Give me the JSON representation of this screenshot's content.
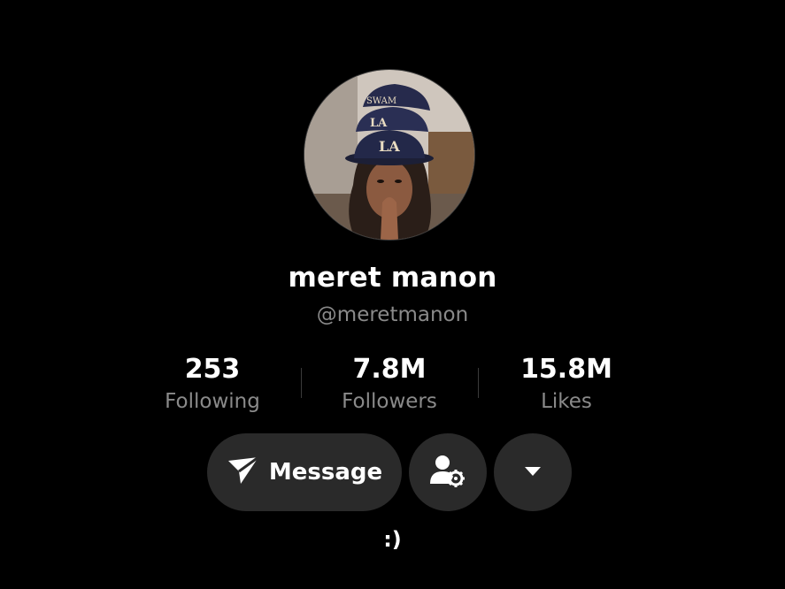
{
  "profile": {
    "display_name": "meret manon",
    "handle": "@meretmanon",
    "bio": ":)"
  },
  "stats": [
    {
      "value": "253",
      "label": "Following"
    },
    {
      "value": "7.8M",
      "label": "Followers"
    },
    {
      "value": "15.8M",
      "label": "Likes"
    }
  ],
  "actions": {
    "message_label": "Message"
  },
  "icons": {
    "message": "send-icon",
    "follow_settings": "user-settings-icon",
    "more": "caret-down-icon"
  },
  "colors": {
    "background": "#000000",
    "button": "#2a2a2a",
    "secondary_text": "#8a8a8a"
  }
}
